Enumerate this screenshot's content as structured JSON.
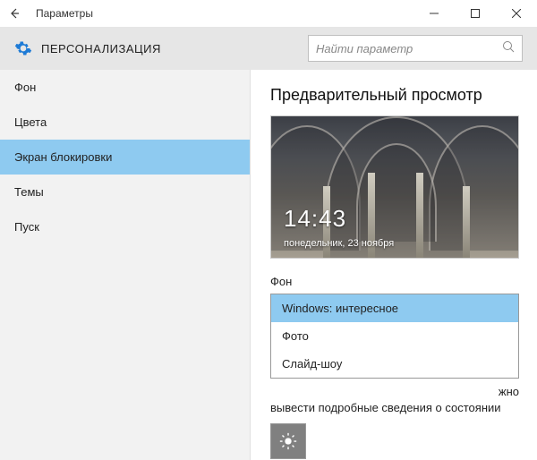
{
  "titlebar": {
    "title": "Параметры"
  },
  "header": {
    "title": "ПЕРСОНАЛИЗАЦИЯ",
    "search_placeholder": "Найти параметр"
  },
  "sidebar": {
    "items": [
      {
        "label": "Фон"
      },
      {
        "label": "Цвета"
      },
      {
        "label": "Экран блокировки"
      },
      {
        "label": "Темы"
      },
      {
        "label": "Пуск"
      }
    ],
    "selected_index": 2
  },
  "content": {
    "preview_title": "Предварительный просмотр",
    "preview_time": "14:43",
    "preview_date": "понедельник, 23 ноября",
    "background_label": "Фон",
    "dropdown": {
      "options": [
        "Windows: интересное",
        "Фото",
        "Слайд-шоу"
      ],
      "selected_index": 0
    },
    "tail_text_right": "жно",
    "tail_text_line": "вывести подробные сведения о состоянии"
  }
}
